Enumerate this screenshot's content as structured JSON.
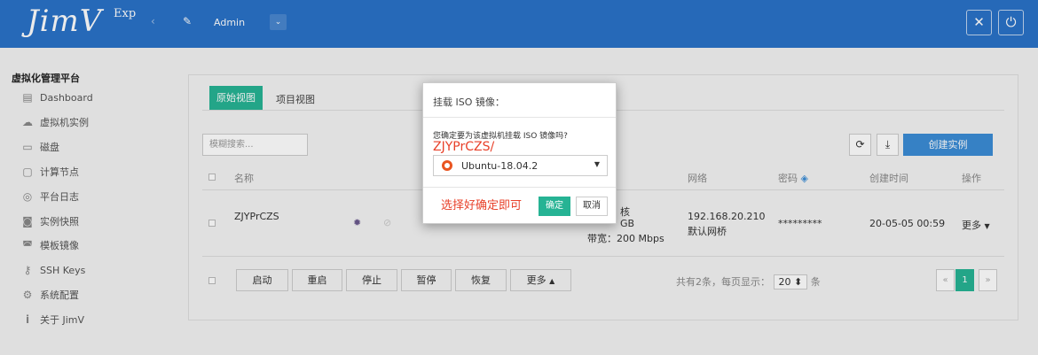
{
  "header": {
    "logo": "JimV",
    "logo_sup": "Exp",
    "user": "Admin",
    "fullscreen_icon": "expand-icon",
    "power_icon": "power-icon"
  },
  "sidebar": {
    "title": "虚拟化管理平台",
    "items": [
      {
        "label": "Dashboard",
        "icon": "dashboard-icon"
      },
      {
        "label": "虚拟机实例",
        "icon": "cloud-icon"
      },
      {
        "label": "磁盘",
        "icon": "disk-icon"
      },
      {
        "label": "计算节点",
        "icon": "monitor-icon"
      },
      {
        "label": "平台日志",
        "icon": "eye-icon"
      },
      {
        "label": "实例快照",
        "icon": "camera-icon"
      },
      {
        "label": "模板镜像",
        "icon": "template-icon"
      },
      {
        "label": "SSH Keys",
        "icon": "key-icon"
      },
      {
        "label": "系统配置",
        "icon": "gear-icon"
      },
      {
        "label": "关于 JimV",
        "icon": "info-icon"
      }
    ]
  },
  "main": {
    "tab_original": "原始视图",
    "tab_project": "项目视图",
    "search_placeholder": "模糊搜索...",
    "create_button": "创建实例",
    "columns": [
      "名称",
      "网络",
      "密码",
      "创建时间",
      "操作"
    ],
    "row": {
      "name": "ZJYPrCZS",
      "cores_partial": "核",
      "mem_partial": "GB",
      "bandwidth": "带宽：200 Mbps",
      "ip": "192.168.20.210",
      "bridge": "默认网桥",
      "password": "*********",
      "created": "20-05-05 00:59",
      "more": "更多"
    },
    "footer_buttons": [
      "启动",
      "重启",
      "停止",
      "暂停",
      "恢复",
      "更多"
    ],
    "pager_total": "共有2条，每页显示：",
    "page_size": "20",
    "pager_unit": "条",
    "current_page": "1"
  },
  "modal": {
    "title": "挂载 ISO 镜像：",
    "question": "您确定要为该虚拟机挂载 ISO 镜像吗?",
    "annotation_name": "ZJYPrCZS/",
    "selected_iso": "Ubuntu-18.04.2",
    "annotation_hint": "选择好确定即可",
    "ok": "确定",
    "cancel": "取消"
  },
  "colors": {
    "header_bg": "#2a72c8",
    "accent_green": "#26b394",
    "primary_blue": "#3b8dd6",
    "annotation_red": "#e8412a"
  }
}
